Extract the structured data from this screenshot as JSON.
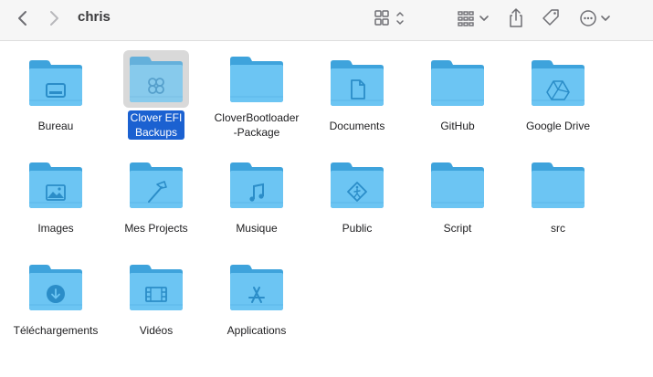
{
  "window": {
    "title": "chris"
  },
  "toolbar": {
    "back_icon": "chevron-left-icon",
    "forward_icon": "chevron-right-icon",
    "view_icon": "icon-view-grid-icon",
    "group_icon": "group-by-icon",
    "share_icon": "share-icon",
    "tag_icon": "tag-icon",
    "more_icon": "more-actions-icon"
  },
  "colors": {
    "folder_back": "#3ea3dc",
    "folder_front": "#6cc5f3",
    "folder_glyph": "#2b8dc8",
    "selection": "#1b61d1"
  },
  "items": [
    {
      "label": "Bureau",
      "glyph": "desktop",
      "selected": false
    },
    {
      "label": "Clover EFI\nBackups",
      "glyph": "clover",
      "selected": true
    },
    {
      "label": "CloverBootloader\n-Package",
      "glyph": "none",
      "selected": false
    },
    {
      "label": "Documents",
      "glyph": "document",
      "selected": false
    },
    {
      "label": "GitHub",
      "glyph": "none",
      "selected": false
    },
    {
      "label": "Google Drive",
      "glyph": "drive",
      "selected": false
    },
    {
      "label": "Images",
      "glyph": "picture",
      "selected": false
    },
    {
      "label": "Mes Projects",
      "glyph": "hammer",
      "selected": false
    },
    {
      "label": "Musique",
      "glyph": "music",
      "selected": false
    },
    {
      "label": "Public",
      "glyph": "public",
      "selected": false
    },
    {
      "label": "Script",
      "glyph": "none",
      "selected": false
    },
    {
      "label": "src",
      "glyph": "none",
      "selected": false
    },
    {
      "label": "Téléchargements",
      "glyph": "download",
      "selected": false
    },
    {
      "label": "Vidéos",
      "glyph": "film",
      "selected": false
    },
    {
      "label": "Applications",
      "glyph": "apps",
      "selected": false
    }
  ]
}
